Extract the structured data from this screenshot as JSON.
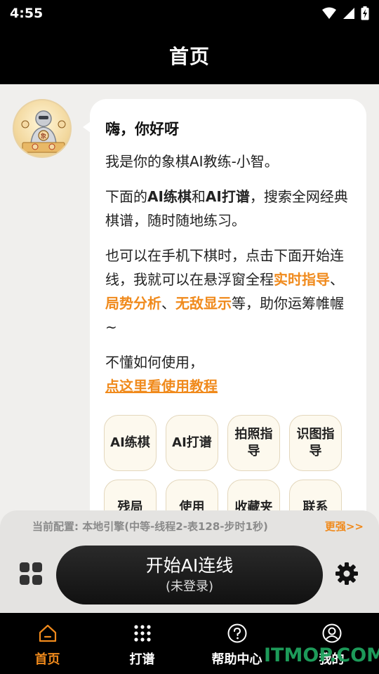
{
  "status_bar": {
    "time": "4:55"
  },
  "header": {
    "title": "首页"
  },
  "coach": {
    "greeting": "嗨，你好呀",
    "intro": "我是你的象棋AI教练-小智。",
    "p2_before": "下面的",
    "p2_ai_training": "AI练棋",
    "p2_and": "和",
    "p2_ai_record": "AI打谱",
    "p2_after": "，搜索全网经典棋谱，随时随地练习。",
    "p3_before": "也可以在手机下棋时，点击下面开始连线，我就可以在悬浮窗全程",
    "p3_hl1": "实时指导",
    "p3_sep1": "、",
    "p3_hl2": "局势分析",
    "p3_sep2": "、",
    "p3_hl3": "无敌显示",
    "p3_after": "等，助你运筹帷幄~",
    "p4": "不懂如何使用，",
    "tutorial_link": "点这里看使用教程"
  },
  "quick_buttons": [
    "AI练棋",
    "AI打谱",
    "拍照指导",
    "识图指导",
    "残局",
    "使用",
    "收藏夹",
    "联系"
  ],
  "bottom": {
    "config": "当前配置: 本地引擎(中等-线程2-表128-步时1秒)",
    "upgrade": "更强>>",
    "start_label": "开始AI连线",
    "start_sub": "(未登录)"
  },
  "nav": [
    {
      "label": "首页",
      "icon": "home-icon",
      "active": true
    },
    {
      "label": "打谱",
      "icon": "dots-grid-icon",
      "active": false
    },
    {
      "label": "帮助中心",
      "icon": "help-icon",
      "active": false
    },
    {
      "label": "我的",
      "icon": "user-icon",
      "active": false
    }
  ],
  "watermark": "ITMOP.COM",
  "colors": {
    "accent": "#f08a1c",
    "dark": "#000000",
    "panel": "#e4e3e1"
  }
}
